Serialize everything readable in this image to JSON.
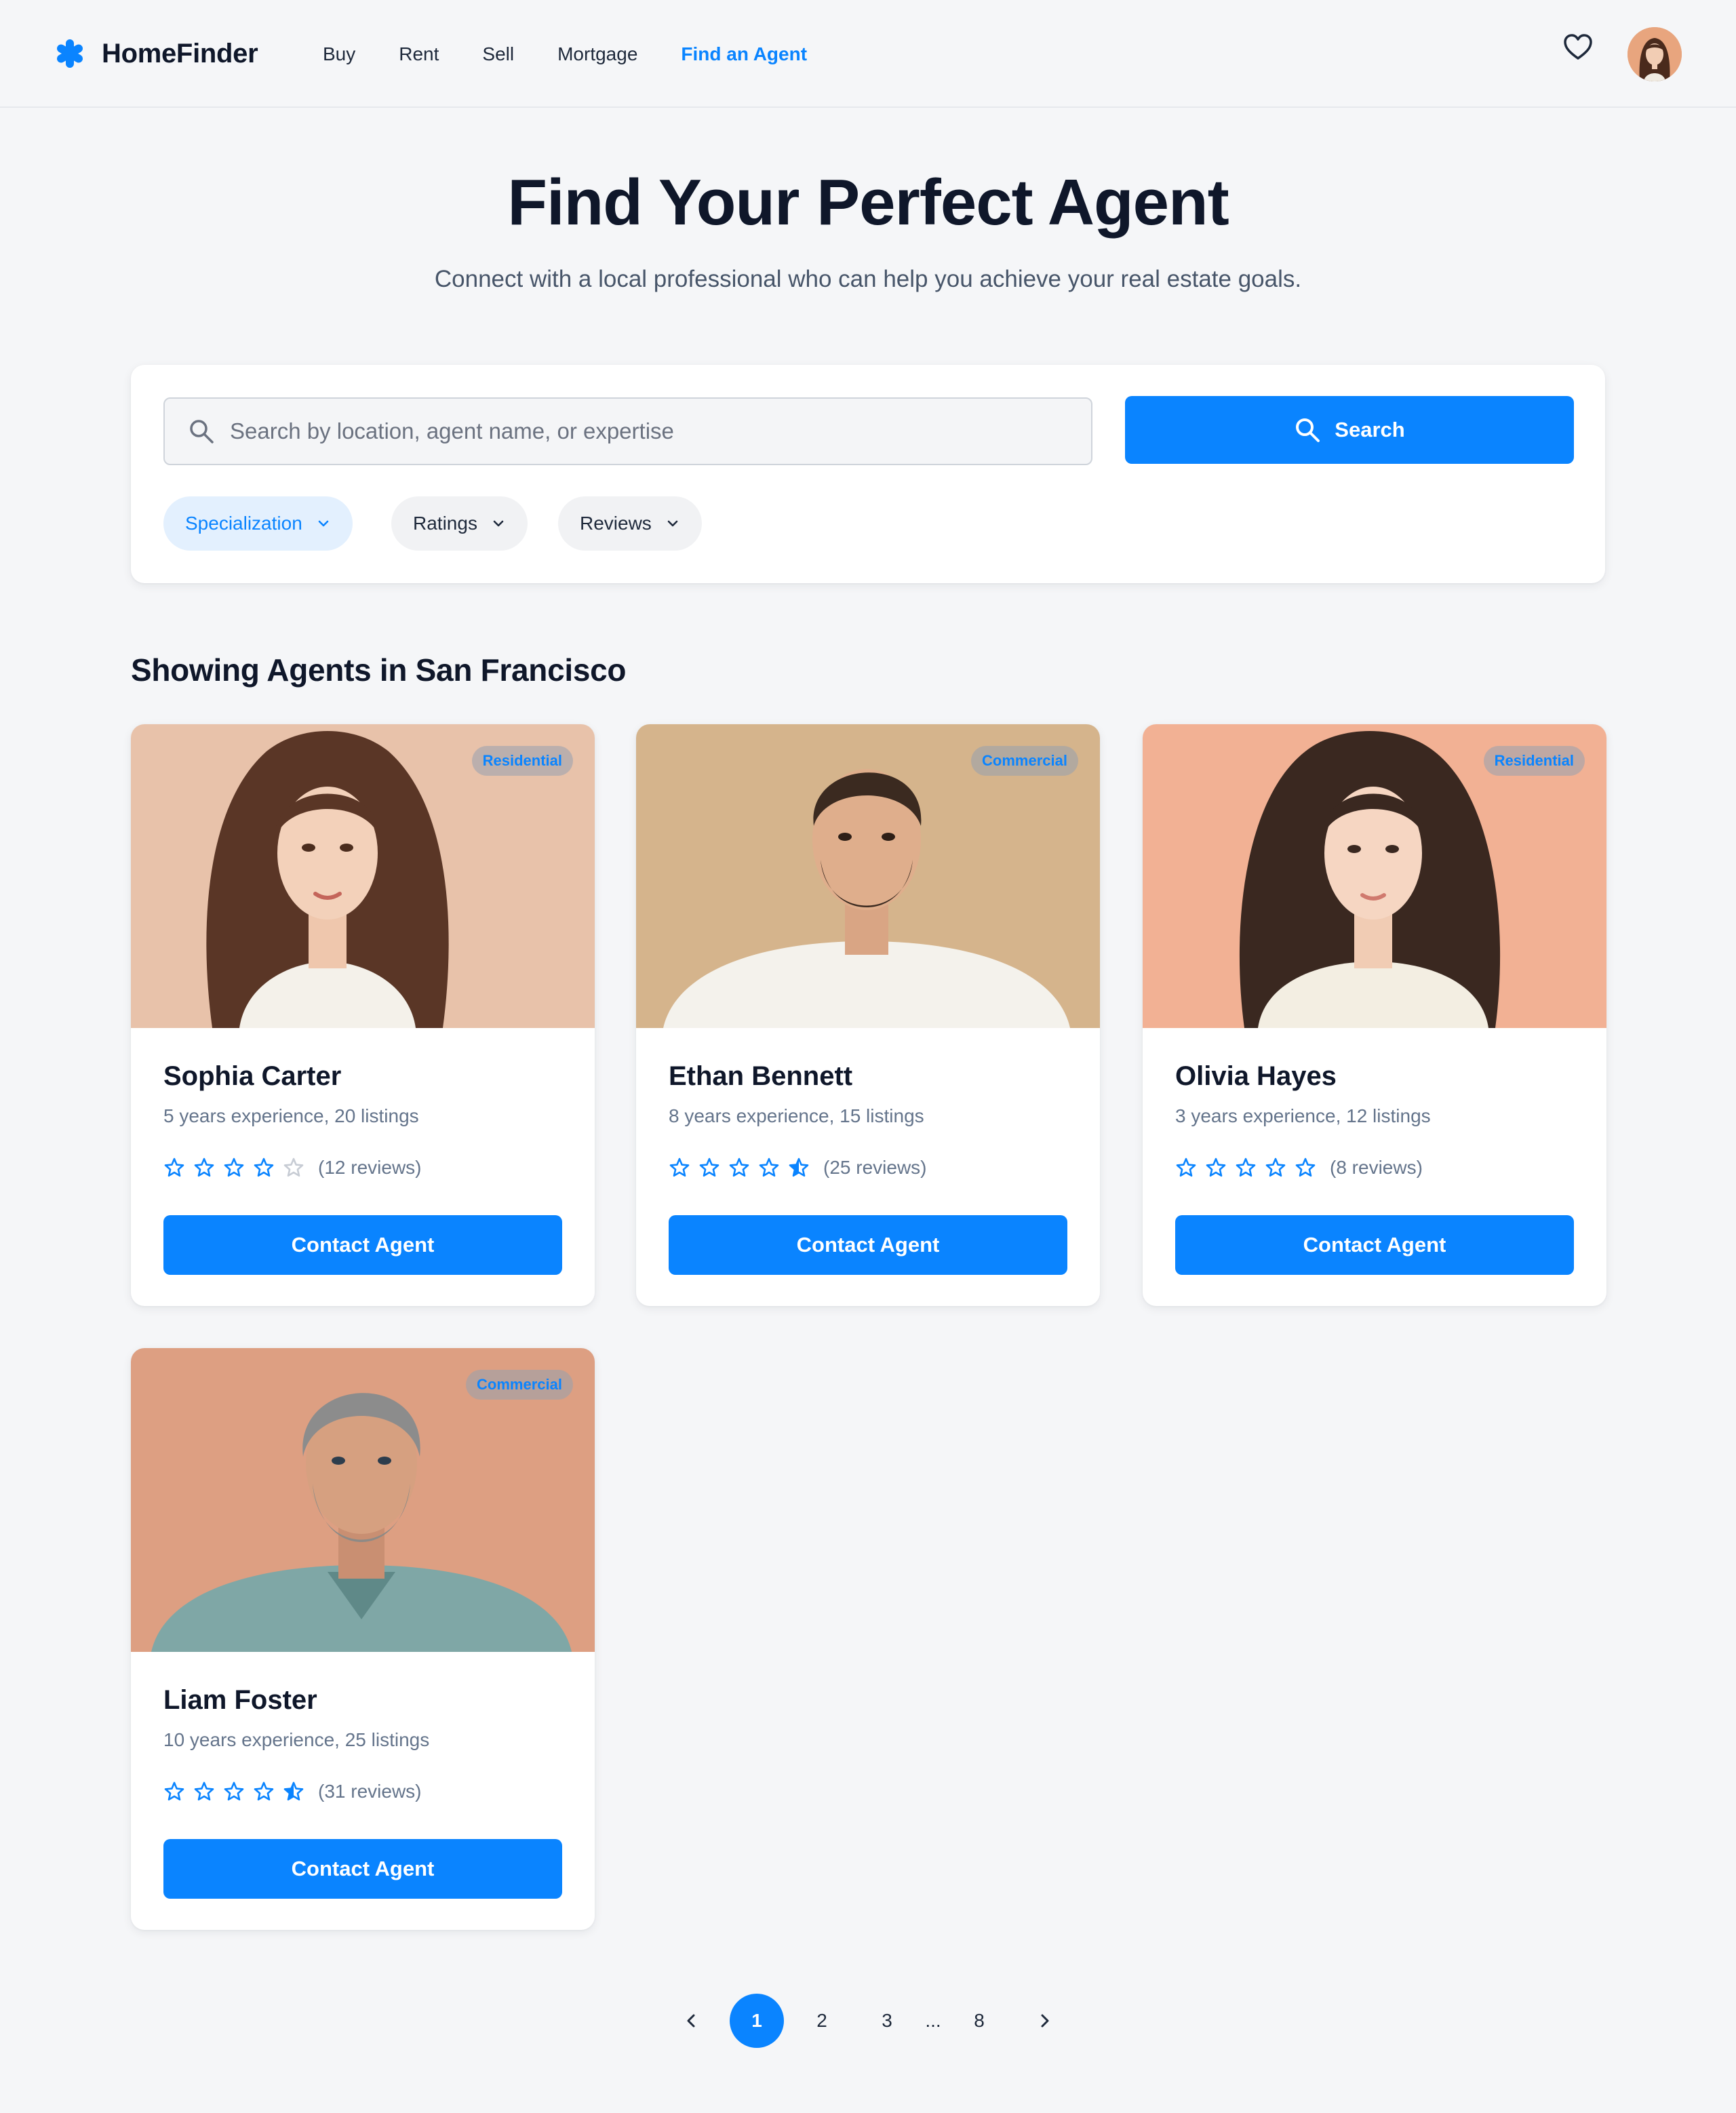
{
  "brand": {
    "name": "HomeFinder",
    "accent": "#0a84ff"
  },
  "nav": {
    "links": [
      {
        "label": "Buy",
        "active": false
      },
      {
        "label": "Rent",
        "active": false
      },
      {
        "label": "Sell",
        "active": false
      },
      {
        "label": "Mortgage",
        "active": false
      },
      {
        "label": "Find an Agent",
        "active": true
      }
    ],
    "icons": [
      "heart-icon",
      "user-avatar"
    ]
  },
  "hero": {
    "title": "Find Your Perfect Agent",
    "subtitle": "Connect with a local professional who can help you achieve your real estate goals."
  },
  "search": {
    "placeholder": "Search by location, agent name, or expertise",
    "value": "",
    "button_label": "Search",
    "filters": [
      {
        "label": "Specialization",
        "active": true
      },
      {
        "label": "Ratings",
        "active": false
      },
      {
        "label": "Reviews",
        "active": false
      }
    ]
  },
  "results": {
    "heading": "Showing Agents in San Francisco",
    "agents": [
      {
        "name": "Sophia Carter",
        "meta": "5 years experience, 20 listings",
        "badge": "Residential",
        "rating": 4,
        "reviews": "(12 reviews)",
        "cta": "Contact Agent"
      },
      {
        "name": "Ethan Bennett",
        "meta": "8 years experience, 15 listings",
        "badge": "Commercial",
        "rating": 4.5,
        "reviews": "(25 reviews)",
        "cta": "Contact Agent"
      },
      {
        "name": "Olivia Hayes",
        "meta": "3 years experience, 12 listings",
        "badge": "Residential",
        "rating": 5,
        "reviews": "(8 reviews)",
        "cta": "Contact Agent"
      },
      {
        "name": "Liam Foster",
        "meta": "10 years experience, 25 listings",
        "badge": "Commercial",
        "rating": 4.5,
        "reviews": "(31 reviews)",
        "cta": "Contact Agent"
      }
    ]
  },
  "pagination": {
    "pages": [
      "1",
      "2",
      "3",
      "...",
      "8"
    ],
    "current": "1"
  }
}
